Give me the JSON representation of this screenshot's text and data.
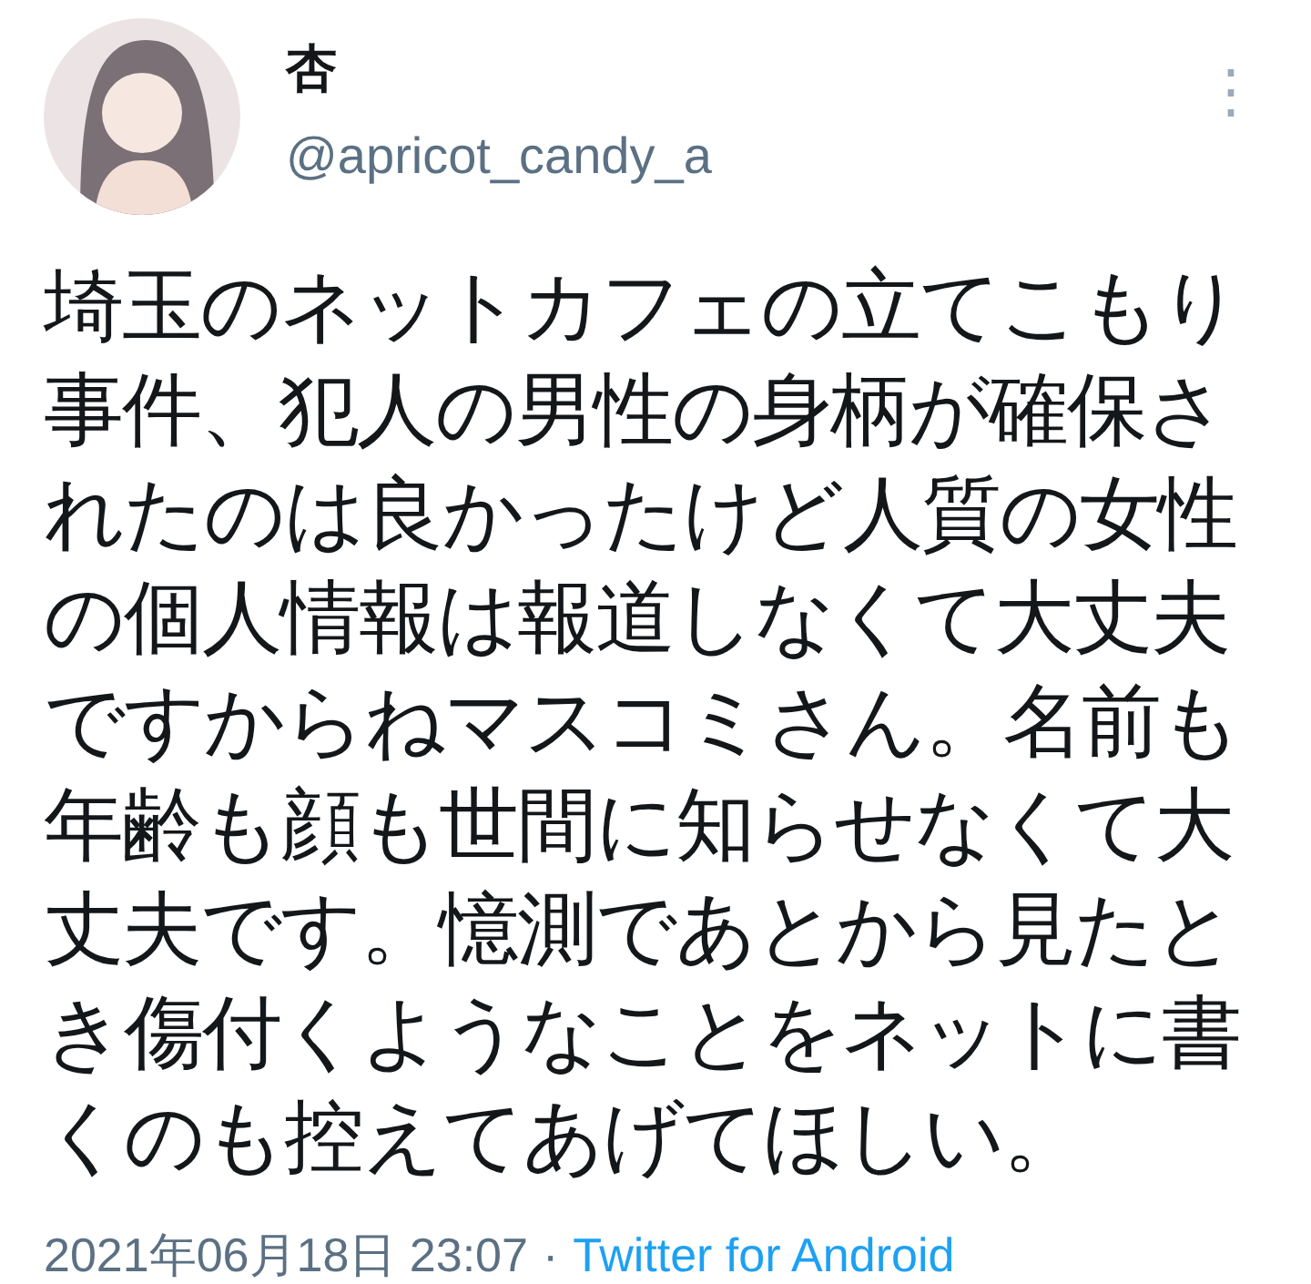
{
  "author": {
    "name": "杏",
    "handle": "@apricot_candy_a"
  },
  "menu_icon": "⋮",
  "body": "埼玉のネットカフェの立てこもり事件、犯人の男性の身柄が確保されたのは良かったけど人質の女性の個人情報は報道しなくて大丈夫ですからねマスコミさん。名前も年齢も顔も世間に知らせなくて大丈夫です。憶測であとから見たとき傷付くようなことをネットに書くのも控えてあげてほしい。",
  "meta": {
    "timestamp": "2021年06月18日 23:07",
    "separator": "·",
    "source": "Twitter for Android"
  }
}
